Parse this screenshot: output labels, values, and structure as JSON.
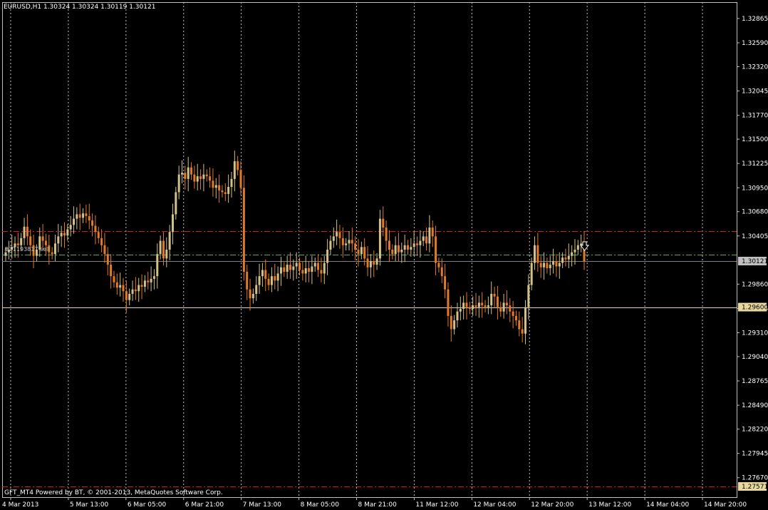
{
  "window": {
    "symbol_info": "EURUSD,H1  1.30324 1.30324 1.30119 1.30121",
    "footer": "GFT_MT4 Powered by BT, © 2001-2013, MetaQuotes Software Corp.",
    "order_label": "#21193817 sell"
  },
  "colors": {
    "background": "#000000",
    "frame": "#c0c0c0",
    "grid": "#c0c0c0",
    "bull": "#d2c28a",
    "bear": "#e07b28",
    "bid_line": "#808080",
    "sell_line": "#4caf50",
    "tp_sl_line": "#d02020",
    "horizontal_line": "#e8d8a0"
  },
  "chart_data": {
    "type": "candlestick",
    "symbol": "EURUSD",
    "timeframe": "H1",
    "ohlc_header": {
      "open": 1.30324,
      "high": 1.30324,
      "low": 1.30119,
      "close": 1.30121
    },
    "ylim": [
      1.2745,
      1.3305
    ],
    "y_ticks": [
      1.32865,
      1.3259,
      1.3232,
      1.32045,
      1.3177,
      1.315,
      1.31225,
      1.3095,
      1.3068,
      1.30405,
      1.2986,
      1.29585,
      1.2931,
      1.2904,
      1.28765,
      1.2849,
      1.2822,
      1.27945,
      1.2767
    ],
    "x_ticks": [
      "4 Mar 2013",
      "5 Mar 13:00",
      "6 Mar 05:00",
      "6 Mar 21:00",
      "7 Mar 13:00",
      "8 Mar 05:00",
      "8 Mar 21:00",
      "11 Mar 12:00",
      "12 Mar 04:00",
      "12 Mar 20:00",
      "13 Mar 12:00",
      "14 Mar 04:00",
      "14 Mar 20:00"
    ],
    "levels": {
      "current_price": {
        "value": 1.30121,
        "label": "1.30121"
      },
      "horizontal_line": {
        "value": 1.296,
        "label": "1.29600"
      },
      "lower_line": {
        "value": 1.27571,
        "label": "1.27571"
      },
      "upper_dashdot": {
        "value": 1.3046
      },
      "sell_order": {
        "value": 1.3019
      }
    },
    "closes": [
      1.3022,
      1.3025,
      1.3028,
      1.3032,
      1.303,
      1.3038,
      1.3051,
      1.304,
      1.303,
      1.3018,
      1.3025,
      1.304,
      1.3035,
      1.303,
      1.3022,
      1.302,
      1.3032,
      1.304,
      1.3044,
      1.3041,
      1.3048,
      1.3053,
      1.306,
      1.3065,
      1.3061,
      1.3066,
      1.3063,
      1.3058,
      1.3052,
      1.3045,
      1.3038,
      1.303,
      1.302,
      1.3008,
      1.2995,
      1.2988,
      1.2982,
      1.2985,
      1.2978,
      1.2968,
      1.2975,
      1.298,
      1.2978,
      1.2985,
      1.2983,
      1.299,
      1.2988,
      1.2992,
      1.2995,
      1.302,
      1.3035,
      1.3015,
      1.3025,
      1.3045,
      1.3065,
      1.309,
      1.311,
      1.3112,
      1.3105,
      1.3118,
      1.311,
      1.3102,
      1.3108,
      1.3105,
      1.311,
      1.3108,
      1.3103,
      1.3095,
      1.3098,
      1.3092,
      1.309,
      1.3088,
      1.3096,
      1.3105,
      1.3125,
      1.3115,
      1.3095,
      1.3,
      1.298,
      1.297,
      1.2975,
      1.2985,
      1.2995,
      1.3002,
      1.2992,
      1.2985,
      1.2995,
      1.299,
      1.2998,
      1.3005,
      1.3,
      1.3008,
      1.3002,
      1.3006,
      1.301,
      1.3002,
      1.2998,
      1.3004,
      1.3,
      1.3006,
      1.301,
      1.3002,
      1.2998,
      1.301,
      1.3025,
      1.3035,
      1.304,
      1.3045,
      1.3038,
      1.303,
      1.3032,
      1.3036,
      1.3032,
      1.3025,
      1.302,
      1.3028,
      1.3015,
      1.3005,
      1.3012,
      1.3008,
      1.3015,
      1.306,
      1.305,
      1.3035,
      1.3025,
      1.302,
      1.303,
      1.3022,
      1.3025,
      1.303,
      1.3025,
      1.3028,
      1.3032,
      1.303,
      1.3035,
      1.304,
      1.3032,
      1.305,
      1.304,
      1.301,
      1.3005,
      1.2995,
      1.298,
      1.295,
      1.2935,
      1.2945,
      1.2955,
      1.2958,
      1.2965,
      1.296,
      1.2958,
      1.2962,
      1.296,
      1.2965,
      1.2962,
      1.296,
      1.2962,
      1.2975,
      1.2972,
      1.296,
      1.2955,
      1.2965,
      1.2962,
      1.2955,
      1.295,
      1.2945,
      1.2935,
      1.293,
      1.296,
      1.2985,
      1.301,
      1.303,
      1.301,
      1.3005,
      1.301,
      1.3004,
      1.3008,
      1.3012,
      1.3006,
      1.301,
      1.3016,
      1.3014,
      1.3018,
      1.3022,
      1.3025,
      1.303,
      1.3032,
      1.3012
    ]
  }
}
